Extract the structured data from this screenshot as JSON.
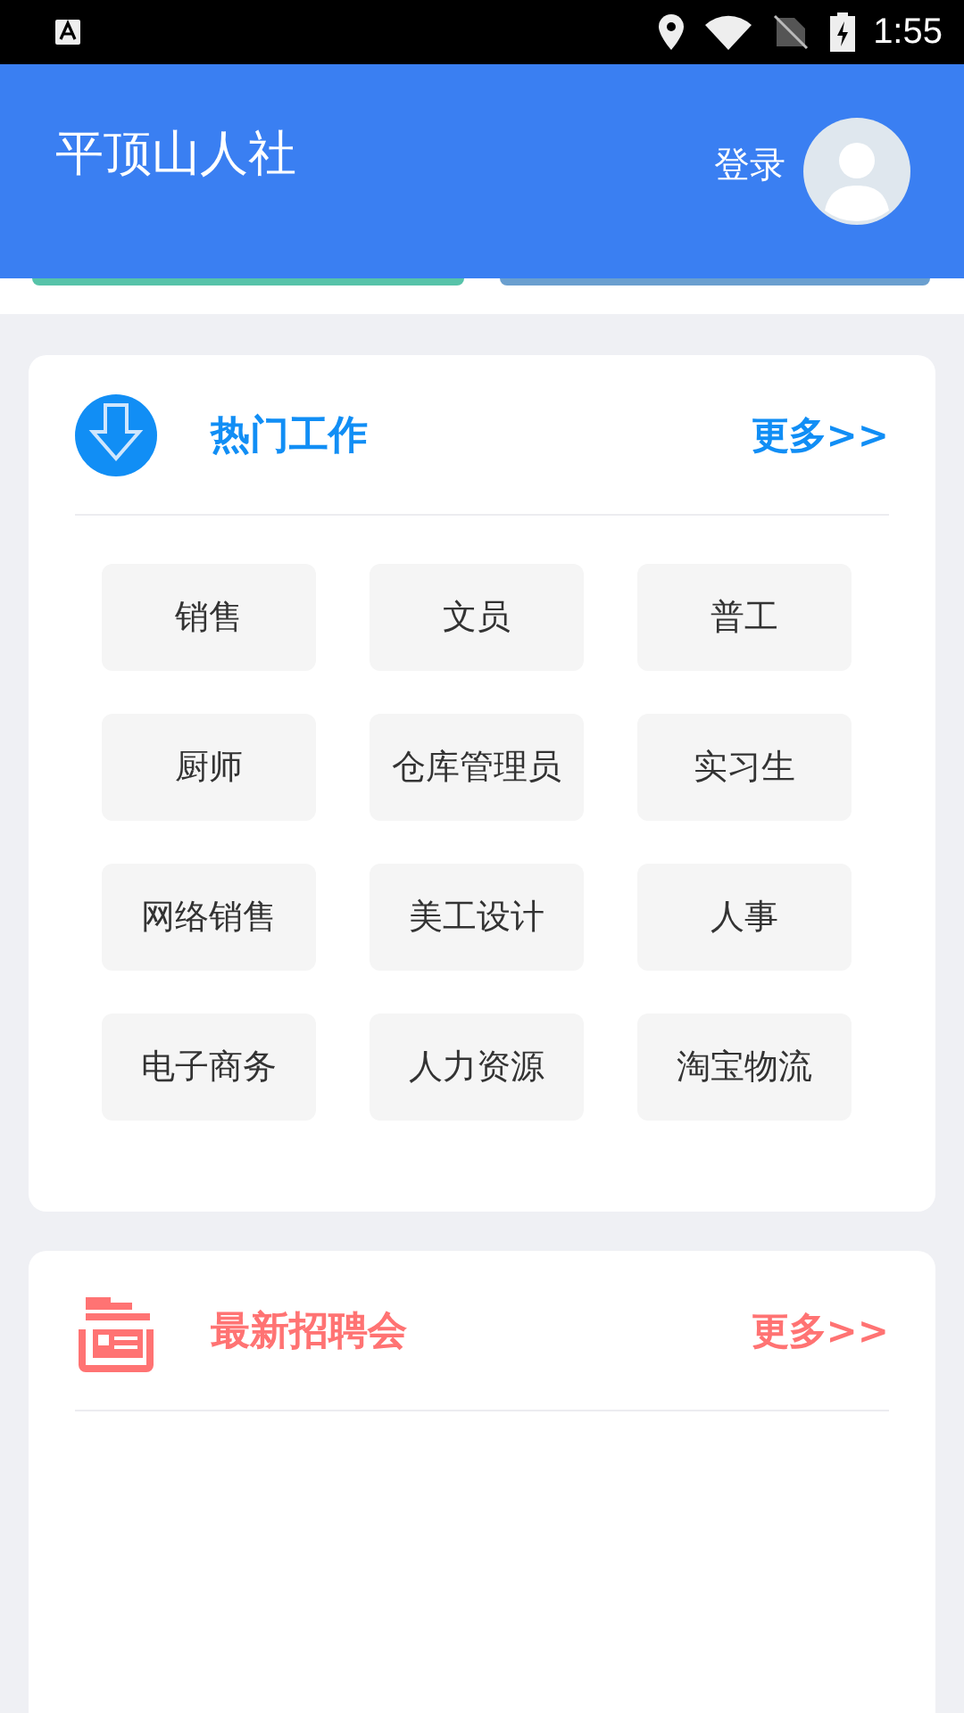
{
  "status_bar": {
    "time": "1:55"
  },
  "header": {
    "title": "平顶山人社",
    "login": "登录"
  },
  "sections": [
    {
      "kind": "download",
      "title": "热门工作",
      "more": "更多>>",
      "color": "#118ef5",
      "jobs": [
        "销售",
        "文员",
        "普工",
        "厨师",
        "仓库管理员",
        "实习生",
        "网络销售",
        "美工设计",
        "人事",
        "电子商务",
        "人力资源",
        "淘宝物流"
      ]
    },
    {
      "kind": "folder",
      "title": "最新招聘会",
      "more": "更多>>",
      "color": "#ff7373"
    }
  ]
}
